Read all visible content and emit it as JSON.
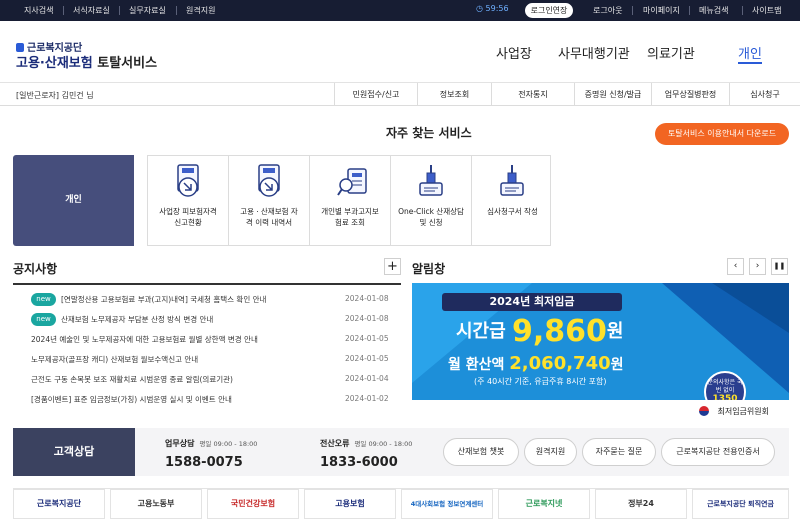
{
  "topbar": {
    "links": [
      "지사검색",
      "서식자료실",
      "실무자료실",
      "원격지원"
    ],
    "timer": "59:56",
    "extend_label": "로그인연장",
    "right_links": [
      "로그아웃",
      "마이페이지",
      "메뉴검색",
      "사이트맵"
    ]
  },
  "header": {
    "logo_small": "근로복지공단",
    "logo_blue": "고용·산재보험",
    "logo_dark": "토탈서비스",
    "nav": [
      "사업장",
      "사무대행기관",
      "의료기관",
      "개인"
    ]
  },
  "subnav": {
    "user": "[일반근로자] 김민건 님",
    "items": [
      "민원접수/신고",
      "정보조회",
      "전자통지",
      "증명원 신청/발급",
      "업무상질병판정",
      "심사청구"
    ]
  },
  "services": {
    "title": "자주 찾는 서비스",
    "download": "토탈서비스 이용안내서 다운로드",
    "category": "개인",
    "items": [
      {
        "line1": "사업장 피보험자격",
        "line2": "신고현황",
        "icon": "document-arrow-icon"
      },
      {
        "line1": "고용ㆍ산재보험 자",
        "line2": "격 이력 내역서",
        "icon": "document-arrow-icon"
      },
      {
        "line1": "개인별 부과고지보",
        "line2": "험료 조회",
        "icon": "document-search-icon"
      },
      {
        "line1": "One-Click 산재상담",
        "line2": "및 신청",
        "icon": "dropper-document-icon"
      },
      {
        "line1": "심사청구서 작성",
        "line2": "",
        "icon": "dropper-document-icon"
      }
    ]
  },
  "notices": {
    "title": "공지사항",
    "more": "+",
    "badge": "new",
    "items": [
      {
        "new": true,
        "text": "[연말정산용 고용보험료 부과(고지)내역] 국세청 홈택스 확인 안내",
        "date": "2024-01-08"
      },
      {
        "new": true,
        "text": "산재보험 노무제공자 부담분 산정 방식 변경 안내",
        "date": "2024-01-08"
      },
      {
        "new": false,
        "text": "2024년 예술인 및 노무제공자에 대한 고용보험료 월별 상한액 변경 안내",
        "date": "2024-01-05"
      },
      {
        "new": false,
        "text": "노무제공자(골프장 캐디) 산재보험 월보수액신고 안내",
        "date": "2024-01-05"
      },
      {
        "new": false,
        "text": "근전도 구동 손목봇 보조 재활치료 시범운영 종료 알림(의료기관)",
        "date": "2024-01-04"
      },
      {
        "new": false,
        "text": "[경품이벤트] 표준 임금정보(가칭) 시범운영 실시 및 이벤트 안내",
        "date": "2024-01-02"
      }
    ]
  },
  "alerts": {
    "title": "알림창",
    "controls": [
      "‹",
      "›",
      "❚❚"
    ],
    "banner": {
      "headline": "2024년 최저임금",
      "hourly_label": "시간급",
      "hourly_value": "9,860",
      "hourly_unit": "원",
      "monthly_label": "월 환산액",
      "monthly_value": "2,060,740",
      "monthly_unit": "원",
      "note": "(주 40시간 기준, 유급주휴 8시간 포함)",
      "circle_text": "문의사항은 국번 없이",
      "circle_number": "1350",
      "org": "최저임금위원회"
    }
  },
  "support": {
    "title": "고객상담",
    "business_label": "업무상담",
    "business_hours": "평일 09:00 - 18:00",
    "business_number": "1588-0075",
    "error_label": "전산오류",
    "error_hours": "평일 09:00 - 18:00",
    "error_number": "1833-6000",
    "buttons": [
      "산재보험 챗봇",
      "원격지원",
      "자주묻는 질문",
      "근로복지공단 전용인증서"
    ]
  },
  "footer_banners": [
    "근로복지공단",
    "고용노동부",
    "국민건강보험",
    "고용보험",
    "4대사회보험 정보연계센터",
    "근로복지넷",
    "정부24",
    "근로복지공단 퇴직연금"
  ]
}
